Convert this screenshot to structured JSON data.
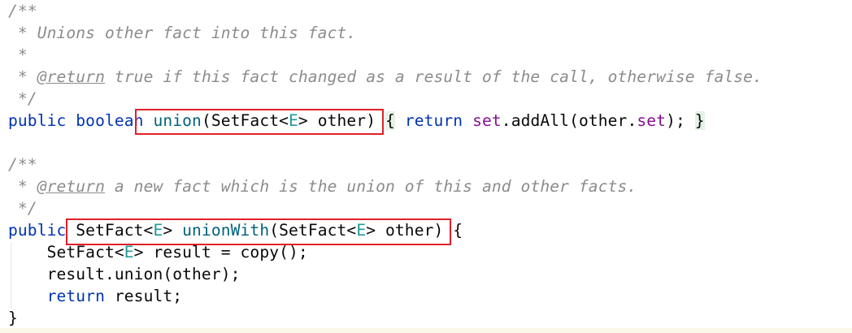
{
  "lines": [
    [
      [
        "cm",
        "/**"
      ]
    ],
    [
      [
        "cm",
        " * Unions other fact into this fact."
      ]
    ],
    [
      [
        "cm",
        " *"
      ]
    ],
    [
      [
        "cm",
        " * "
      ],
      [
        "tag",
        "@return"
      ],
      [
        "cm",
        " true if this fact changed as a result of the call, otherwise false."
      ]
    ],
    [
      [
        "cm",
        " */"
      ]
    ],
    [
      [
        "kw",
        "public "
      ],
      [
        "kw",
        "boolean "
      ],
      [
        "md",
        "union"
      ],
      [
        "pl",
        "(SetFact<"
      ],
      [
        "tp",
        "E"
      ],
      [
        "pl",
        "> other) "
      ],
      [
        "fold pl",
        "{"
      ],
      [
        "pl",
        " "
      ],
      [
        "kw",
        "return "
      ],
      [
        "fd",
        "set"
      ],
      [
        "pl",
        ".addAll(other."
      ],
      [
        "fd",
        "set"
      ],
      [
        "pl",
        "); "
      ],
      [
        "fold pl",
        "}"
      ]
    ],
    [
      [
        "pl",
        ""
      ]
    ],
    [
      [
        "cm",
        "/**"
      ]
    ],
    [
      [
        "cm",
        " * "
      ],
      [
        "tag",
        "@return"
      ],
      [
        "cm",
        " a new fact which is the union of this and other facts."
      ]
    ],
    [
      [
        "cm",
        " */"
      ]
    ],
    [
      [
        "kw",
        "public "
      ],
      [
        "pl",
        "SetFact<"
      ],
      [
        "tp",
        "E"
      ],
      [
        "pl",
        "> "
      ],
      [
        "md",
        "unionWith"
      ],
      [
        "pl",
        "(SetFact<"
      ],
      [
        "tp",
        "E"
      ],
      [
        "pl",
        "> other) {"
      ]
    ],
    [
      [
        "pl",
        "    SetFact<"
      ],
      [
        "tp",
        "E"
      ],
      [
        "pl",
        "> result = copy();"
      ]
    ],
    [
      [
        "pl",
        "    result.union(other);"
      ]
    ],
    [
      [
        "kw",
        "    return "
      ],
      [
        "pl",
        "result;"
      ]
    ],
    [
      [
        "pl",
        "}"
      ]
    ]
  ]
}
